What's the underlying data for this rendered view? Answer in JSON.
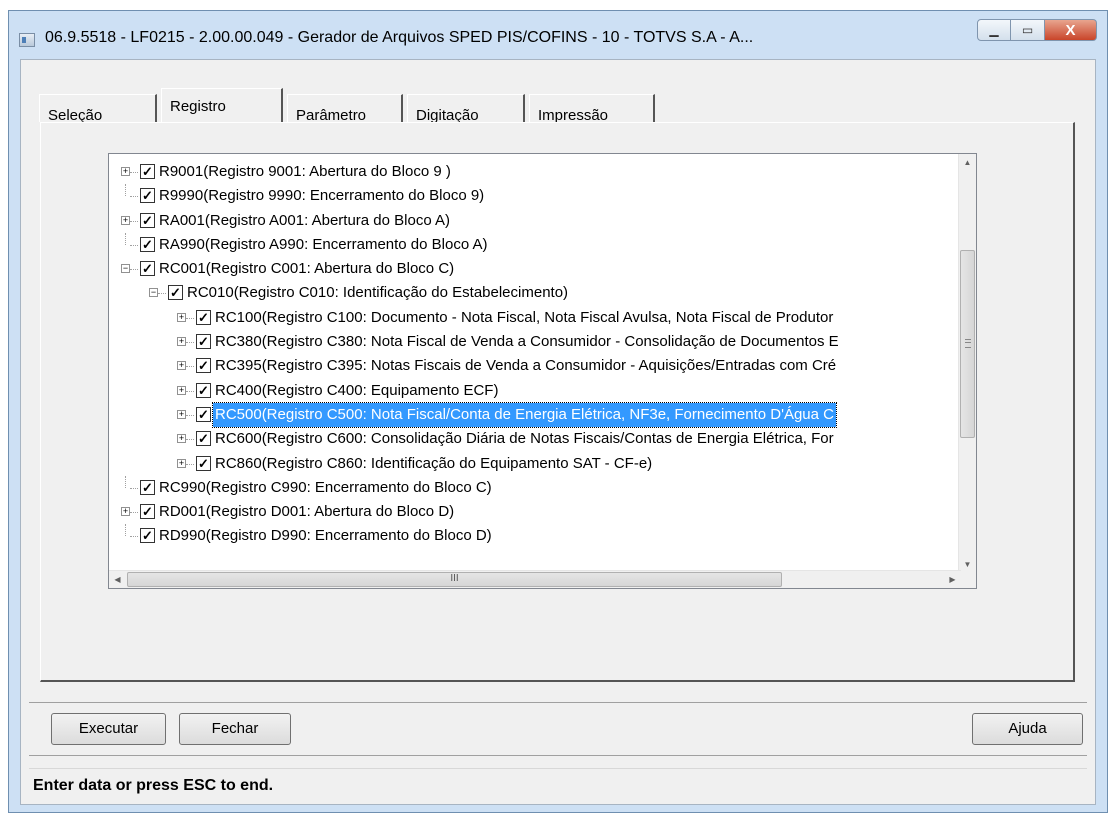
{
  "window": {
    "title": "06.9.5518 - LF0215 - 2.00.00.049 - Gerador de Arquivos SPED PIS/COFINS - 10 - TOTVS S.A - A...",
    "min_glyph": "▁",
    "max_glyph": "▭",
    "close_glyph": "X"
  },
  "tabs": [
    {
      "label": "Seleção"
    },
    {
      "label": "Registro",
      "active": true
    },
    {
      "label": "Parâmetro"
    },
    {
      "label": "Digitação"
    },
    {
      "label": "Impressão"
    }
  ],
  "tree": {
    "items": [
      {
        "label": "R9001(Registro 9001: Abertura do Bloco 9    )",
        "level": 0,
        "expandable": true,
        "expanded": false,
        "checked": true
      },
      {
        "label": "R9990(Registro 9990: Encerramento do Bloco 9)",
        "level": 0,
        "expandable": false,
        "checked": true
      },
      {
        "label": "RA001(Registro A001: Abertura do Bloco A)",
        "level": 0,
        "expandable": true,
        "expanded": false,
        "checked": true
      },
      {
        "label": "RA990(Registro A990: Encerramento do Bloco A)",
        "level": 0,
        "expandable": false,
        "checked": true
      },
      {
        "label": "RC001(Registro C001: Abertura do Bloco C)",
        "level": 0,
        "expandable": true,
        "expanded": true,
        "checked": true
      },
      {
        "label": "RC010(Registro C010: Identificação do Estabelecimento)",
        "level": 1,
        "expandable": true,
        "expanded": true,
        "checked": true
      },
      {
        "label": "RC100(Registro C100: Documento - Nota Fiscal, Nota Fiscal Avulsa, Nota Fiscal de Produtor",
        "level": 2,
        "expandable": true,
        "expanded": false,
        "checked": true
      },
      {
        "label": "RC380(Registro C380: Nota Fiscal de Venda a Consumidor - Consolidação de Documentos E",
        "level": 2,
        "expandable": true,
        "expanded": false,
        "checked": true
      },
      {
        "label": "RC395(Registro C395: Notas Fiscais de Venda a Consumidor - Aquisições/Entradas com Cré",
        "level": 2,
        "expandable": true,
        "expanded": false,
        "checked": true
      },
      {
        "label": "RC400(Registro C400: Equipamento ECF)",
        "level": 2,
        "expandable": true,
        "expanded": false,
        "checked": true
      },
      {
        "label": "RC500(Registro C500: Nota Fiscal/Conta de Energia Elétrica, NF3e, Fornecimento D'Água C",
        "level": 2,
        "expandable": true,
        "expanded": false,
        "checked": true,
        "selected": true
      },
      {
        "label": "RC600(Registro C600: Consolidação Diária de Notas Fiscais/Contas de Energia Elétrica, For",
        "level": 2,
        "expandable": true,
        "expanded": false,
        "checked": true
      },
      {
        "label": "RC860(Registro C860: Identificação do Equipamento SAT - CF-e)",
        "level": 2,
        "expandable": true,
        "expanded": false,
        "checked": true
      },
      {
        "label": "RC990(Registro C990: Encerramento do Bloco C)",
        "level": 0,
        "expandable": false,
        "checked": true
      },
      {
        "label": "RD001(Registro D001: Abertura do Bloco D)",
        "level": 0,
        "expandable": true,
        "expanded": false,
        "checked": true
      },
      {
        "label": "RD990(Registro D990: Encerramento do Bloco D)",
        "level": 0,
        "expandable": false,
        "checked": true
      }
    ],
    "scroll_up_glyph": "▲",
    "scroll_down_glyph": "▼",
    "scroll_left_glyph": "◀",
    "scroll_right_glyph": "▶",
    "hthumb_grip": "III"
  },
  "buttons": {
    "executar": "Executar",
    "fechar": "Fechar",
    "ajuda": "Ajuda"
  },
  "status": "Enter data or press ESC to end."
}
